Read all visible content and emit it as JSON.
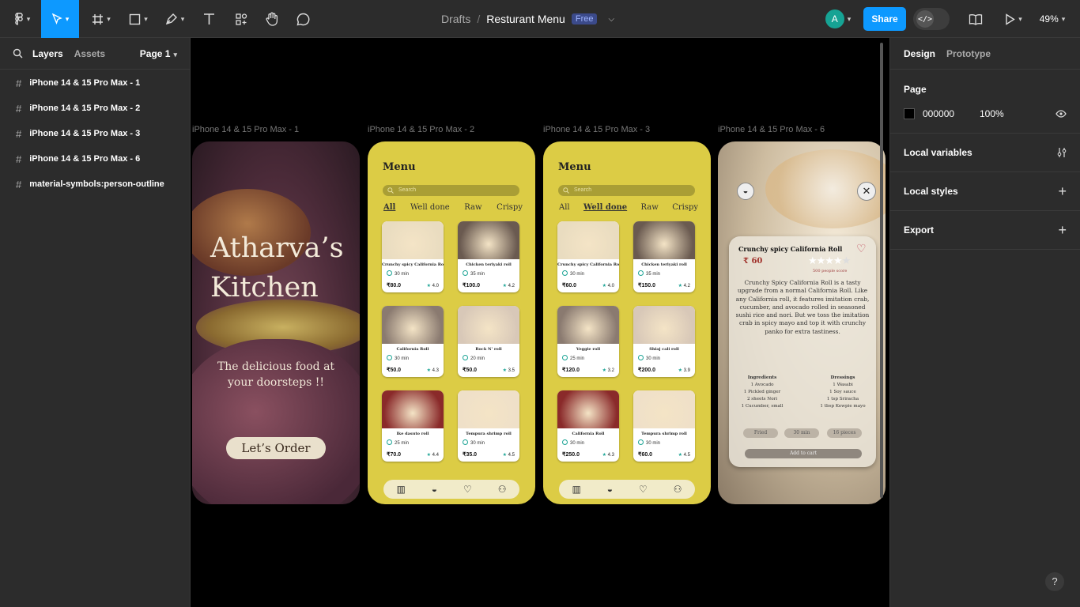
{
  "toolbar": {
    "project": "Drafts",
    "separator": "/",
    "file": "Resturant Menu",
    "plan": "Free",
    "avatar": "A",
    "share": "Share",
    "zoom": "49%"
  },
  "left_panel": {
    "tabs": [
      "Layers",
      "Assets"
    ],
    "page": "Page 1",
    "layers": [
      "iPhone 14 & 15 Pro Max - 1",
      "iPhone 14 & 15 Pro Max - 2",
      "iPhone 14 & 15 Pro Max - 3",
      "iPhone 14 & 15 Pro Max - 6",
      "material-symbols:person-outline"
    ]
  },
  "right_panel": {
    "tabs": [
      "Design",
      "Prototype"
    ],
    "page_label": "Page",
    "page_color": "000000",
    "page_opacity": "100%",
    "sections": [
      "Local variables",
      "Local styles",
      "Export"
    ]
  },
  "frames": {
    "labels": [
      "iPhone 14 & 15 Pro Max - 1",
      "iPhone 14 & 15 Pro Max - 2",
      "iPhone 14 & 15 Pro Max - 3",
      "iPhone 14 & 15 Pro Max - 6"
    ],
    "splash": {
      "title1": "Atharva’s",
      "title2": "Kitchen",
      "tagline1": "The delicious food at",
      "tagline2": "your doorsteps !!",
      "cta": "Let’s Order"
    },
    "menu": {
      "title": "Menu",
      "search": "Search",
      "tabs": [
        "All",
        "Well done",
        "Raw",
        "Crispy"
      ]
    },
    "menu2_cards": [
      {
        "name": "Crunchy spicy California Roll",
        "time": "30 min",
        "price": "₹80.0",
        "rating": "4.0"
      },
      {
        "name": "Chicken teriyaki roll",
        "time": "35 min",
        "price": "₹100.0",
        "rating": "4.2"
      },
      {
        "name": "California Roll",
        "time": "30 min",
        "price": "₹50.0",
        "rating": "4.3"
      },
      {
        "name": "Rock N' roll",
        "time": "20 min",
        "price": "₹50.0",
        "rating": "3.5"
      },
      {
        "name": "Ike dasuto roll",
        "time": "25 min",
        "price": "₹70.0",
        "rating": "4.4"
      },
      {
        "name": "Tempura shrimp roll",
        "time": "30 min",
        "price": "₹35.0",
        "rating": "4.5"
      }
    ],
    "menu3_cards": [
      {
        "name": "Crunchy spicy California Roll",
        "time": "30 min",
        "price": "₹60.0",
        "rating": "4.0"
      },
      {
        "name": "Chicken teriyaki roll",
        "time": "35 min",
        "price": "₹150.0",
        "rating": "4.2"
      },
      {
        "name": "Veggie roll",
        "time": "25 min",
        "price": "₹120.0",
        "rating": "3.2"
      },
      {
        "name": "Shiaj cali roll",
        "time": "30 min",
        "price": "₹200.0",
        "rating": "3.9"
      },
      {
        "name": "California Roll",
        "time": "30 min",
        "price": "₹250.0",
        "rating": "4.3"
      },
      {
        "name": "Tempura shrimp roll",
        "time": "30 min",
        "price": "₹60.0",
        "rating": "4.5"
      }
    ],
    "detail": {
      "name": "Crunchy spicy California Roll",
      "price": "₹ 60",
      "score": "500 people score",
      "desc": "Crunchy Spicy California Roll is a tasty upgrade from a normal California Roll. Like any California roll, it features imitation crab, cucumber, and avocado rolled in seasoned sushi rice and nori. But we toss the imitation crab in spicy mayo and top it with crunchy panko for extra tastiness.",
      "ingredients_title": "Ingredients",
      "ingredients": [
        "1 Avocado",
        "1 Pickled ginger",
        "2 sheets Nori",
        "1 Cucumber, small"
      ],
      "dressings_title": "Dressings",
      "dressings": [
        "1 Wasabi",
        "1 Soy sauce",
        "1 tsp Sriracha",
        "1 tbsp Kewpie mayo"
      ],
      "chips": [
        "Fried",
        "30 min",
        "16 pieces"
      ],
      "add": "Add to cart"
    }
  }
}
